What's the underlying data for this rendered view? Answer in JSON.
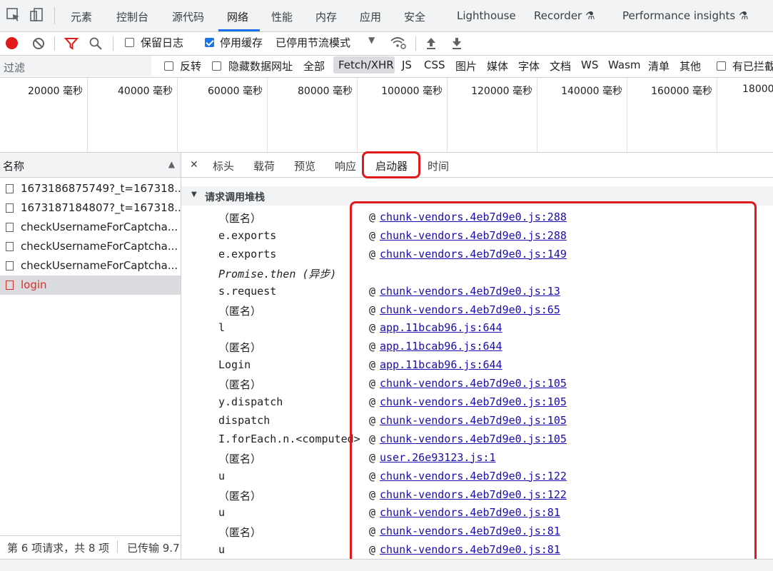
{
  "tabbar": {
    "tabs": [
      "元素",
      "控制台",
      "源代码",
      "网络",
      "性能",
      "内存",
      "应用",
      "安全",
      "Lighthouse",
      "Recorder ⚗",
      "Performance insights ⚗"
    ],
    "active_index": 3
  },
  "toolbar": {
    "preserve_log": "保留日志",
    "disable_cache": "停用缓存",
    "throttle": "已停用节流模式",
    "disable_cache_checked": true
  },
  "filterbar": {
    "filter_label": "过滤",
    "invert": "反转",
    "hide_data_urls": "隐藏数据网址",
    "types": [
      "全部",
      "Fetch/XHR",
      "JS",
      "CSS",
      "图片",
      "媒体",
      "字体",
      "文档",
      "WS",
      "Wasm",
      "清单",
      "其他"
    ],
    "active_type": "Fetch/XHR",
    "blocked": "有已拦截"
  },
  "timeline": {
    "ticks": [
      "20000 毫秒",
      "40000 毫秒",
      "60000 毫秒",
      "80000 毫秒",
      "100000 毫秒",
      "120000 毫秒",
      "140000 毫秒",
      "160000 毫秒",
      "18000"
    ]
  },
  "left": {
    "column_name": "名称",
    "requests": [
      {
        "name": "1673186875749?_t=167318...",
        "status": "normal"
      },
      {
        "name": "1673187184807?_t=167318...",
        "status": "normal"
      },
      {
        "name": "checkUsernameForCaptcha...",
        "status": "normal"
      },
      {
        "name": "checkUsernameForCaptcha...",
        "status": "normal"
      },
      {
        "name": "checkUsernameForCaptcha...",
        "status": "normal"
      },
      {
        "name": "login",
        "status": "error"
      }
    ],
    "status_requests": "第 6 项请求，共 8 项",
    "status_transferred": "已传输 9.7"
  },
  "detail": {
    "tabs": [
      "标头",
      "载荷",
      "预览",
      "响应",
      "启动器",
      "时间"
    ],
    "active_tab": "启动器",
    "stack_title": "请求调用堆栈",
    "frames": [
      {
        "fn": "（匿名）",
        "src": "chunk-vendors.4eb7d9e0.js:288"
      },
      {
        "fn": "e.exports",
        "src": "chunk-vendors.4eb7d9e0.js:288"
      },
      {
        "fn": "e.exports",
        "src": "chunk-vendors.4eb7d9e0.js:149"
      },
      {
        "fn": "Promise.then (异步)",
        "src": "",
        "async": true
      },
      {
        "fn": "s.request",
        "src": "chunk-vendors.4eb7d9e0.js:13"
      },
      {
        "fn": "（匿名）",
        "src": "chunk-vendors.4eb7d9e0.js:65"
      },
      {
        "fn": "l",
        "src": "app.11bcab96.js:644"
      },
      {
        "fn": "（匿名）",
        "src": "app.11bcab96.js:644"
      },
      {
        "fn": "Login",
        "src": "app.11bcab96.js:644"
      },
      {
        "fn": "（匿名）",
        "src": "chunk-vendors.4eb7d9e0.js:105"
      },
      {
        "fn": "y.dispatch",
        "src": "chunk-vendors.4eb7d9e0.js:105"
      },
      {
        "fn": "dispatch",
        "src": "chunk-vendors.4eb7d9e0.js:105"
      },
      {
        "fn": "I.forEach.n.<computed>",
        "src": "chunk-vendors.4eb7d9e0.js:105"
      },
      {
        "fn": "（匿名）",
        "src": "user.26e93123.js:1"
      },
      {
        "fn": "u",
        "src": "chunk-vendors.4eb7d9e0.js:122"
      },
      {
        "fn": "（匿名）",
        "src": "chunk-vendors.4eb7d9e0.js:122"
      },
      {
        "fn": "u",
        "src": "chunk-vendors.4eb7d9e0.js:81"
      },
      {
        "fn": "（匿名）",
        "src": "chunk-vendors.4eb7d9e0.js:81"
      },
      {
        "fn": "u",
        "src": "chunk-vendors.4eb7d9e0.js:81"
      }
    ]
  },
  "colors": {
    "accent": "#1a73e8",
    "record": "#e0191b",
    "highlight": "#e0191b",
    "link": "#1a0dab",
    "error": "#d93025"
  }
}
